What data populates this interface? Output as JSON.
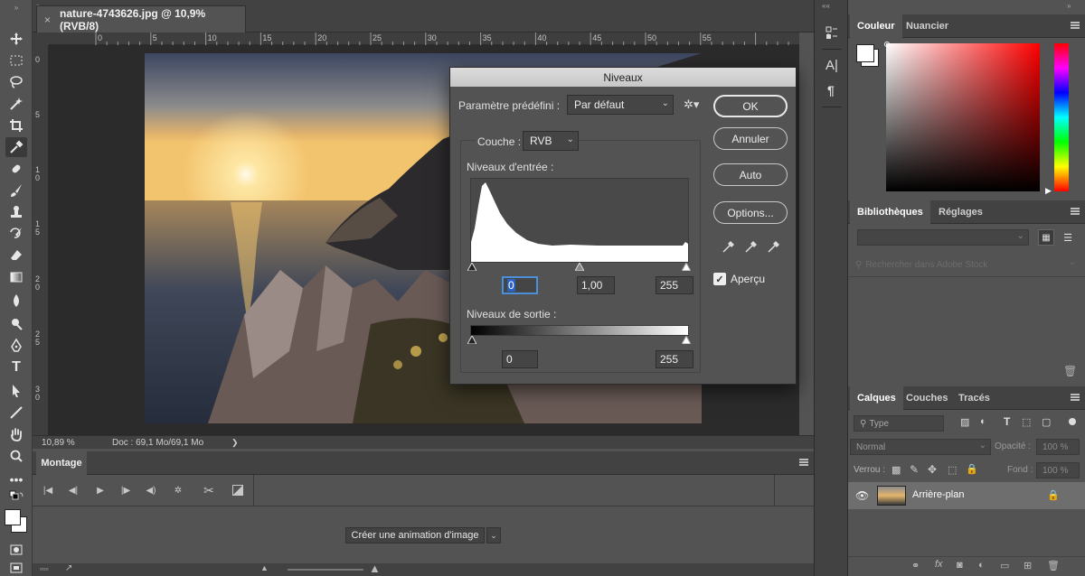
{
  "document": {
    "tab_title": "nature-4743626.jpg @ 10,9% (RVB/8)",
    "close_glyph": "×",
    "zoom": "10,89 %",
    "doc_info": "Doc : 69,1 Mo/69,1 Mo",
    "status_arrow": "❯"
  },
  "rulers": {
    "h": [
      "0",
      "5",
      "10",
      "15",
      "20",
      "25",
      "30",
      "35",
      "40",
      "45",
      "50",
      "55"
    ],
    "v": [
      "0",
      "5",
      "1\n0",
      "1\n5",
      "2\n0",
      "2\n5",
      "3\n0"
    ]
  },
  "timeline": {
    "tab": "Montage",
    "create_button": "Créer une animation d'image"
  },
  "levels_dialog": {
    "title": "Niveaux",
    "preset_label": "Paramètre prédéfini :",
    "preset_value": "Par défaut",
    "channel_label": "Couche :",
    "channel_value": "RVB",
    "input_label": "Niveaux d'entrée :",
    "output_label": "Niveaux de sortie :",
    "input_black": "0",
    "input_mid": "1,00",
    "input_white": "255",
    "output_black": "0",
    "output_white": "255",
    "buttons": {
      "ok": "OK",
      "cancel": "Annuler",
      "auto": "Auto",
      "options": "Options..."
    },
    "preview_label": "Aperçu",
    "preview_checked": true
  },
  "color_panel": {
    "tabs": [
      "Couleur",
      "Nuancier"
    ]
  },
  "libraries_panel": {
    "tabs": [
      "Bibliothèques",
      "Réglages"
    ],
    "search_placeholder": "Rechercher dans Adobe Stock"
  },
  "layers_panel": {
    "tabs": [
      "Calques",
      "Couches",
      "Tracés"
    ],
    "filter_label": "Type",
    "blend_mode": "Normal",
    "opacity_label": "Opacité :",
    "opacity_value": "100 %",
    "lock_label": "Verrou :",
    "fill_label": "Fond :",
    "fill_value": "100 %",
    "layer_name": "Arrière-plan"
  },
  "colors": {
    "accent": "#1473e6",
    "dialog_title": "#d4d4d4"
  }
}
